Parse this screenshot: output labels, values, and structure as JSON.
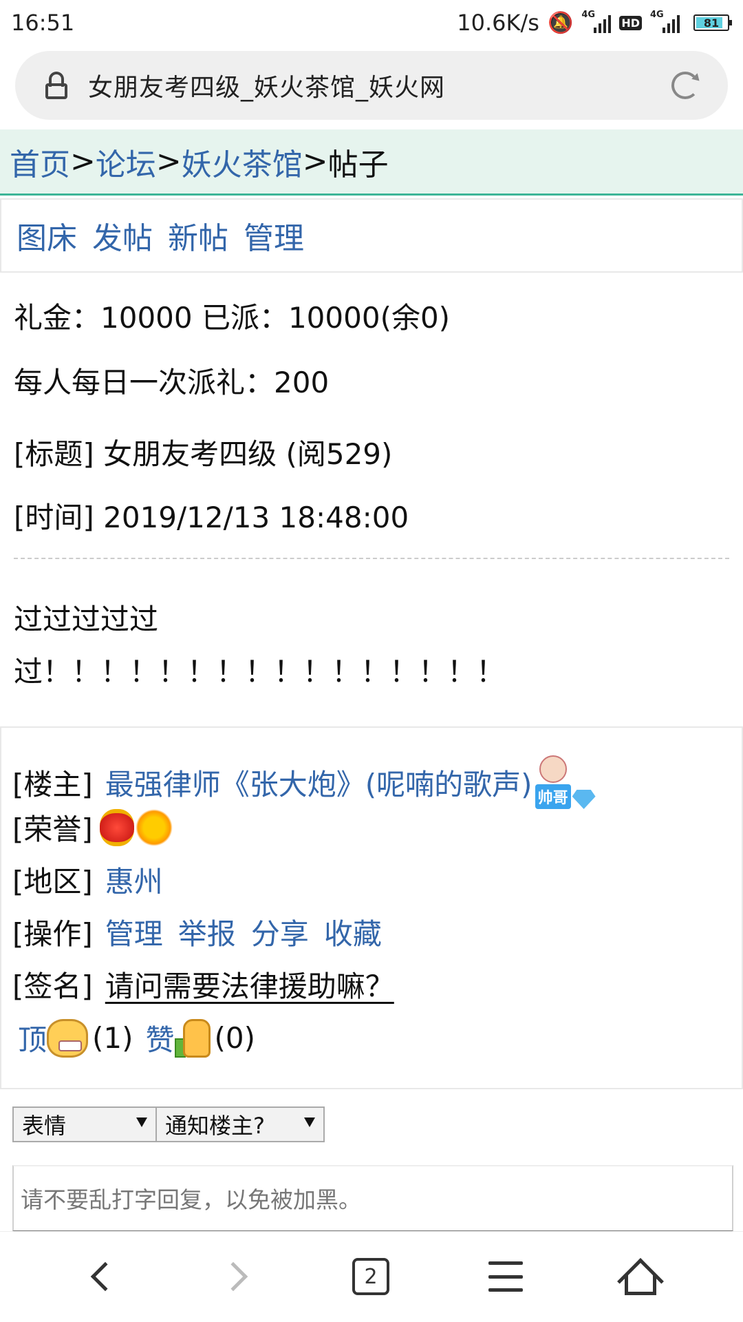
{
  "status_bar": {
    "time": "16:51",
    "net_speed": "10.6K/s",
    "hd": "HD",
    "network": "4G",
    "battery": "81"
  },
  "address_bar": {
    "title": "女朋友考四级_妖火茶馆_妖火网"
  },
  "breadcrumb": {
    "items": [
      "首页",
      "论坛",
      "妖火茶馆"
    ],
    "separator": ">",
    "current": "帖子"
  },
  "nav": {
    "links": [
      "图床",
      "发帖",
      "新帖",
      "管理"
    ]
  },
  "post": {
    "gift_line": "礼金：10000 已派：10000(余0)",
    "daily_gift": "每人每日一次派礼：200",
    "title_line": "[标题] 女朋友考四级 (阅529)",
    "time_line": "[时间] 2019/12/13 18:48:00",
    "body_line1": "过过过过过",
    "body_line2": "过！！！！！！！！！！！！！！！！"
  },
  "author": {
    "owner_label": "[楼主]",
    "owner_name": "最强律师《张大炮》(呢喃的歌声)",
    "badge_text": "帅哥",
    "honor_label": "[荣誉]",
    "region_label": "[地区]",
    "region_value": "惠州",
    "actions_label": "[操作]",
    "actions": [
      "管理",
      "举报",
      "分享",
      "收藏"
    ],
    "signature_label": "[签名]",
    "signature": "请问需要法律援助嘛？"
  },
  "reactions": {
    "top_label": "顶",
    "top_count": "(1)",
    "like_label": "赞",
    "like_count": "(0)"
  },
  "reply_form": {
    "emoji_select": "表情",
    "notify_select": "通知楼主?",
    "placeholder": "请不要乱打字回复，以免被加黑。"
  },
  "bottom_nav": {
    "tab_count": "2"
  },
  "colors": {
    "link": "#3366aa",
    "breadcrumb_bg": "#e6f4ee",
    "breadcrumb_border": "#3eb598"
  }
}
